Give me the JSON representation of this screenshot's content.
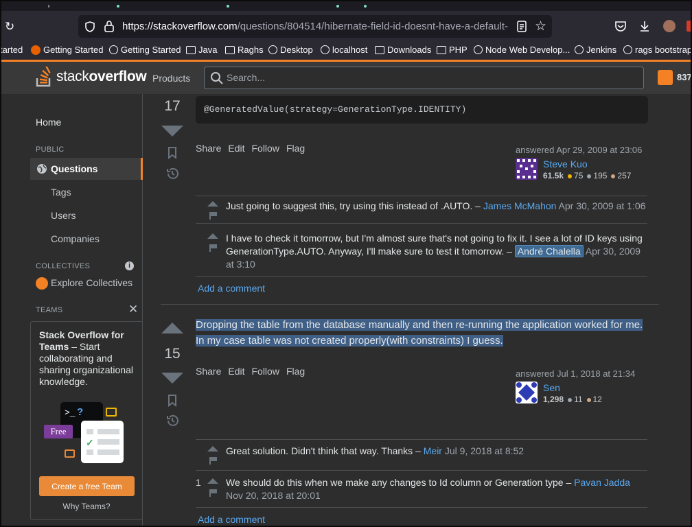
{
  "browser": {
    "url_host": "https://stackoverflow.com",
    "url_path": "/questions/804514/hibernate-field-id-doesnt-have-a-default-",
    "bookmarks": [
      "tarted",
      "Getting Started",
      "Getting Started",
      "Java",
      "Raghs",
      "Desktop",
      "localhost",
      "Downloads",
      "PHP",
      "Node Web Develop...",
      "Jenkins",
      "rags bootstrap"
    ]
  },
  "header": {
    "logo_light": "stack",
    "logo_bold": "overflow",
    "products_label": "Products",
    "search_placeholder": "Search...",
    "rep": "837"
  },
  "nav": {
    "home": "Home",
    "public_label": "PUBLIC",
    "questions": "Questions",
    "tags": "Tags",
    "users": "Users",
    "companies": "Companies",
    "collectives_label": "COLLECTIVES",
    "explore_collectives": "Explore Collectives",
    "teams_label": "TEAMS",
    "teams_title": "Stack Overflow for Teams",
    "teams_desc": "– Start collaborating and sharing organizational knowledge.",
    "free_badge": "Free",
    "create_team": "Create a free Team",
    "why_teams": "Why Teams?"
  },
  "answer1": {
    "votes": "17",
    "code": "@GeneratedValue(strategy=GenerationType.IDENTITY)",
    "menu": [
      "Share",
      "Edit",
      "Follow",
      "Flag"
    ],
    "answered": "answered Apr 29, 2009 at 23:06",
    "user": "Steve Kuo",
    "rep": "61.5k",
    "gold": "75",
    "silver": "195",
    "bronze": "257",
    "comments": [
      {
        "text": "Just going to suggest this, try using this instead of .AUTO. – ",
        "user": "James McMahon",
        "when": " Apr 30, 2009 at 1:06"
      },
      {
        "text": "I have to check it tomorrow, but I'm almost sure that's not going to fix it. I see a lot of ID keys using GenerationType.AUTO. Anyway, I'll make sure to test it tomorrow. – ",
        "user": "André Chalella",
        "when": " Apr 30, 2009 at 3:10"
      }
    ],
    "add_comment": "Add a comment"
  },
  "answer2": {
    "votes": "15",
    "text": "Dropping the table from the database manually and then re-running the application worked for me. In my case table was not created properly(with constraints) I guess.",
    "menu": [
      "Share",
      "Edit",
      "Follow",
      "Flag"
    ],
    "answered": "answered Jul 1, 2018 at 21:34",
    "user": "Sen",
    "rep": "1,298",
    "silver": "11",
    "bronze": "12",
    "comments": [
      {
        "score": "",
        "text": "Great solution. Didn't think that way. Thanks – ",
        "user": "Meir",
        "when": " Jul 9, 2018 at 8:52"
      },
      {
        "score": "1",
        "text": "We should do this when we make any changes to Id column or Generation type – ",
        "user": "Pavan Jadda",
        "when": " Nov 20, 2018 at 20:01"
      }
    ],
    "add_comment": "Add a comment"
  },
  "colors": {
    "accent": "#f48225",
    "link": "#59a8f0",
    "gold": "#f1b600",
    "silver": "#9fa6ad",
    "bronze": "#d1a684"
  }
}
